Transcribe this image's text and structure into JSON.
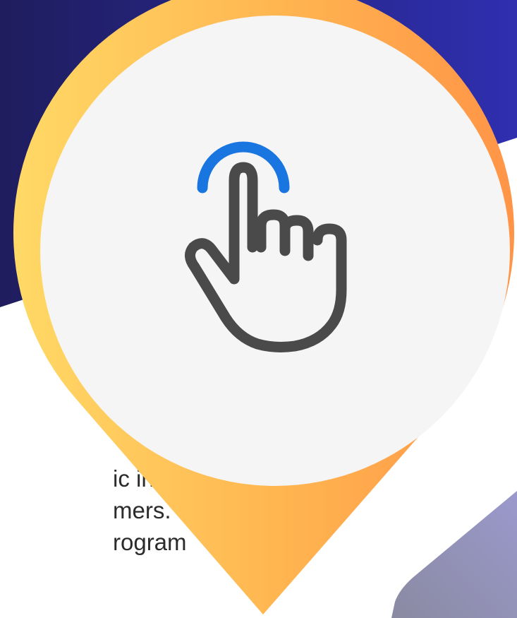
{
  "body_text": {
    "lines": [
      "ic into",
      "mers.",
      "rogram"
    ]
  },
  "icons": {
    "main": "tap-gesture-icon"
  },
  "colors": {
    "navy_dark": "#1f1d5e",
    "navy_light": "#2f2fb0",
    "pin_yellow": "#ffd966",
    "pin_orange": "#ff9447",
    "circle_fill": "#f5f5f5",
    "hand_stroke": "#4a4a4a",
    "tap_arc": "#1976e0",
    "corner_shape": "#8e8ca8"
  }
}
